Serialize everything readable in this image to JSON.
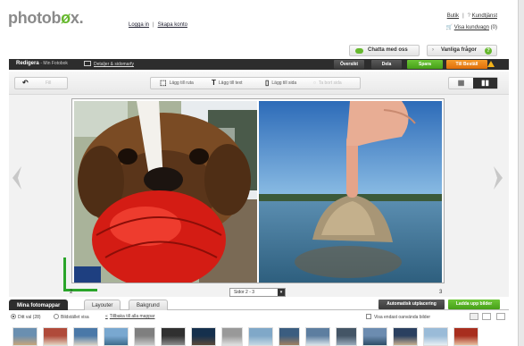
{
  "brand": {
    "name_pre": "photob",
    "name_x": "ø",
    "name_post": "x."
  },
  "header": {
    "login": "Logga in",
    "signup": "Skapa konto",
    "shop": "Butik",
    "customer_service": "Kundtjänst",
    "cart": "Visa kundvagn",
    "cart_count": "(0)"
  },
  "support": {
    "chat": "Chatta med oss",
    "faq": "Vanliga frågor",
    "faq_icon": "?"
  },
  "editbar": {
    "title": "Redigera",
    "subtitle": "- Min Fotobok",
    "details": "Detaljer & sidomarfy",
    "overview": "Översikt",
    "share": "Dela",
    "save": "Spara",
    "finish": "Till Beställ"
  },
  "toolbar": {
    "add_image": "Lägg till ruta",
    "add_text": "Lägg till text",
    "add_page": "Lägg till sida",
    "delete": "Ta bort sida",
    "fill": "Fill"
  },
  "pages": {
    "left_num": "2",
    "right_num": "3",
    "selector": "Sidor 2 - 3",
    "selector_arrow": "▾"
  },
  "tabs": {
    "photos": "Mina fotomappar",
    "layouts": "Layouter",
    "backgrounds": "Bakgrund",
    "auto_layout": "Automatisk utplacering",
    "upload": "Ladda upp bilder"
  },
  "filters": {
    "all": "Ditt val (28)",
    "sort": "Bildstället visa",
    "back": "Tillbaka till alla mappar",
    "unused": "Visa endast oanvända bilder"
  },
  "colors": {
    "accent_green": "#66b82e",
    "accent_orange": "#e9740f",
    "bar_dark": "#2d2d2d"
  },
  "thumbnails": [
    {
      "c1": "#6a8fb0",
      "c2": "#c7a57b"
    },
    {
      "c1": "#b04a3a",
      "c2": "#e3d2c0"
    },
    {
      "c1": "#4a78a8",
      "c2": "#d9d2c4"
    },
    {
      "c1": "#79a8d0",
      "c2": "#3d6b8c"
    },
    {
      "c1": "#7f7f7f",
      "c2": "#c9c9c9"
    },
    {
      "c1": "#303030",
      "c2": "#8d8d8d"
    },
    {
      "c1": "#15304d",
      "c2": "#5b4a3a"
    },
    {
      "c1": "#999999",
      "c2": "#e0e0e0"
    },
    {
      "c1": "#80a8c8",
      "c2": "#c4d8e4"
    },
    {
      "c1": "#3b5d80",
      "c2": "#a08060"
    },
    {
      "c1": "#5d7ea0",
      "c2": "#d8e3ea"
    },
    {
      "c1": "#445566",
      "c2": "#9aaabb"
    },
    {
      "c1": "#6c8cb0",
      "c2": "#2d4d66"
    },
    {
      "c1": "#2a4060",
      "c2": "#c8b090"
    },
    {
      "c1": "#9abbd8",
      "c2": "#e6eef4"
    },
    {
      "c1": "#a82e1e",
      "c2": "#e8c0a0"
    }
  ]
}
